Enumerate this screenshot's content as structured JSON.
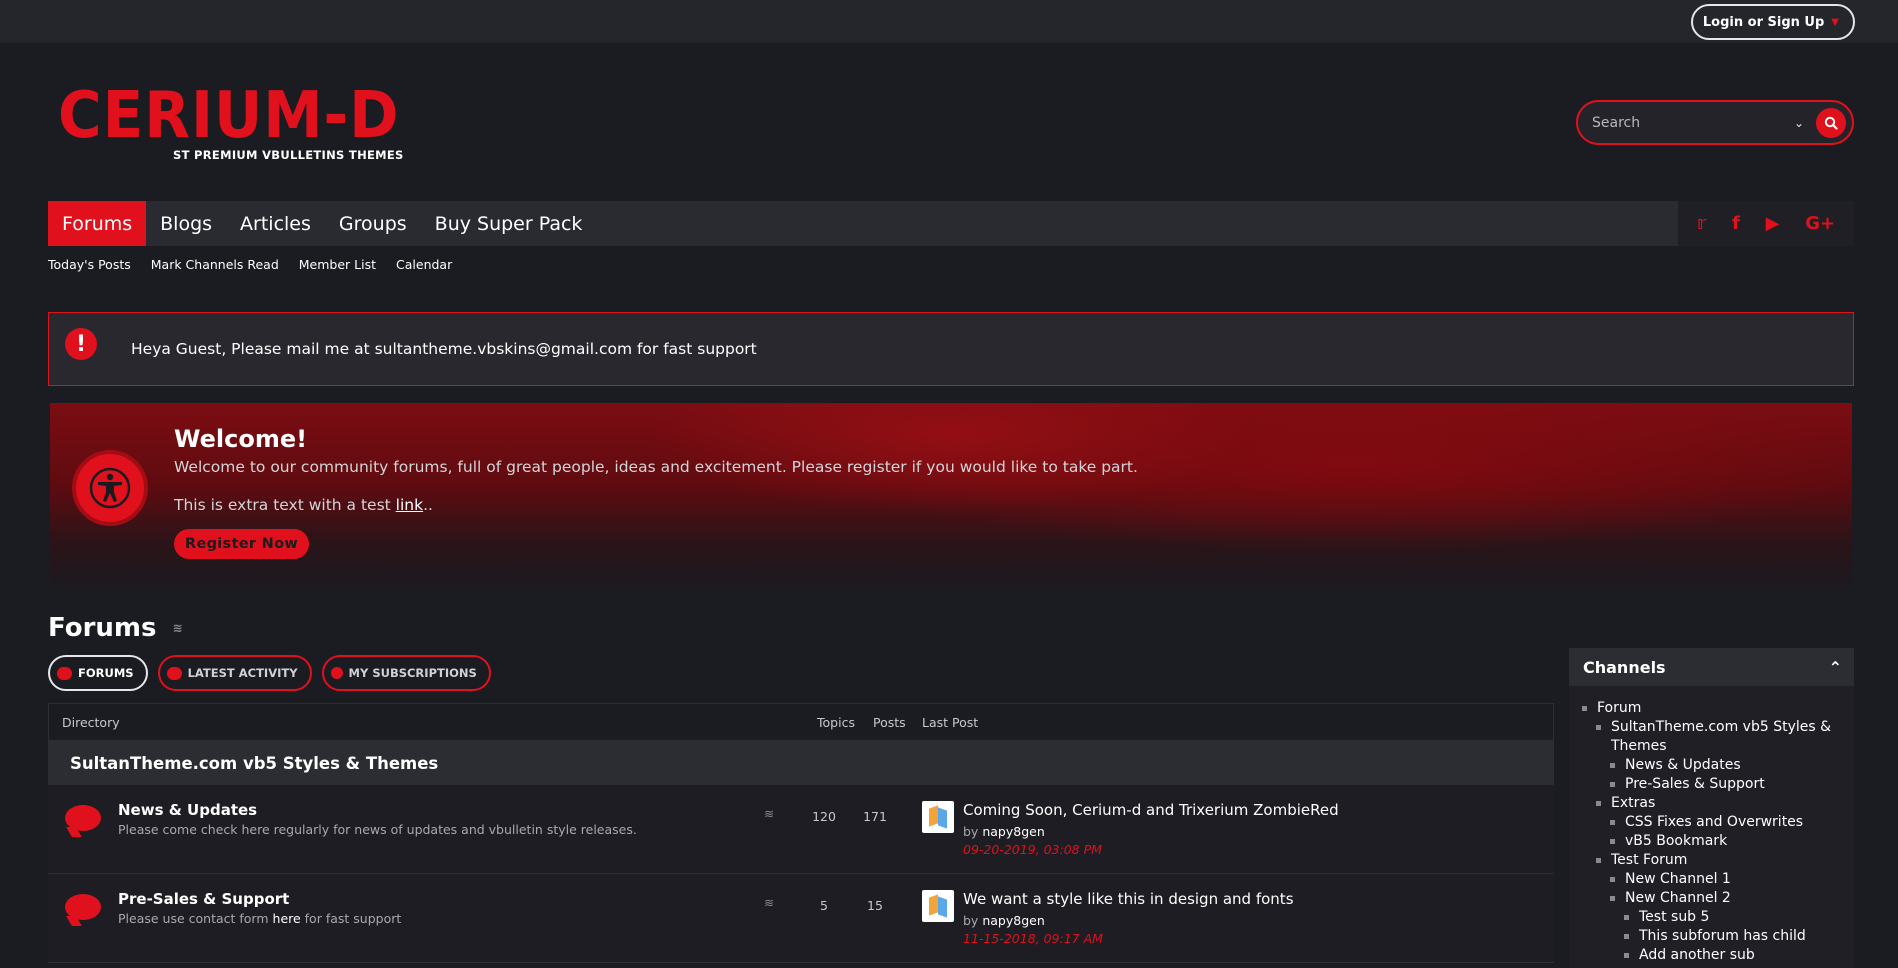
{
  "topbar": {
    "login_label": "Login or Sign Up"
  },
  "logo": {
    "main": "CERIUM-D",
    "sub": "ST PREMIUM VBULLETINS THEMES"
  },
  "search": {
    "placeholder": "Search"
  },
  "nav": {
    "tabs": [
      "Forums",
      "Blogs",
      "Articles",
      "Groups",
      "Buy Super Pack"
    ],
    "social": [
      "twitter-icon",
      "facebook-icon",
      "youtube-icon",
      "google-plus-icon"
    ]
  },
  "subnav": [
    "Today's Posts",
    "Mark Channels Read",
    "Member List",
    "Calendar"
  ],
  "notice": {
    "text": "Heya Guest, Please mail me at sultantheme.vbskins@gmail.com for fast support"
  },
  "welcome": {
    "title": "Welcome!",
    "description": "Welcome to our community forums, full of great people, ideas and excitement. Please register if you would like to take part.",
    "extra_before": "This is extra text with a test ",
    "extra_link": "link",
    "extra_after": "..",
    "register_label": "Register Now"
  },
  "forums": {
    "title": "Forums",
    "tabs": [
      "FORUMS",
      "LATEST ACTIVITY",
      "MY SUBSCRIPTIONS"
    ],
    "columns": {
      "directory": "Directory",
      "topics": "Topics",
      "posts": "Posts",
      "last_post": "Last Post"
    },
    "section_title": "SultanTheme.com vb5 Styles & Themes",
    "rows": [
      {
        "title": "News & Updates",
        "description": "Please come check here regularly for news of updates and vbulletin style releases.",
        "topics": "120",
        "posts": "171",
        "last_title": "Coming Soon, Cerium-d and Trixerium ZombieRed",
        "last_by_prefix": "by",
        "last_user": "napy8gen",
        "last_date": "09-20-2019, 03:08 PM"
      },
      {
        "title": "Pre-Sales & Support",
        "description_before": "Please use contact form ",
        "description_link": "here",
        "description_after": " for fast support",
        "topics": "5",
        "posts": "15",
        "last_title": "We want a style like this in design and fonts",
        "last_by_prefix": "by",
        "last_user": "napy8gen",
        "last_date": "11-15-2018, 09:17 AM"
      }
    ]
  },
  "channels": {
    "title": "Channels",
    "items": [
      "Forum",
      "SultanTheme.com vb5 Styles & Themes",
      "News & Updates",
      "Pre-Sales & Support",
      "Extras",
      "CSS Fixes and Overwrites",
      "vB5 Bookmark",
      "Test Forum",
      "New Channel 1",
      "New Channel 2",
      "Test sub 5",
      "This subforum has child",
      "Add another sub"
    ]
  },
  "colors": {
    "accent": "#e0111c",
    "background": "#1b1b22",
    "panel": "#2a2a31"
  }
}
